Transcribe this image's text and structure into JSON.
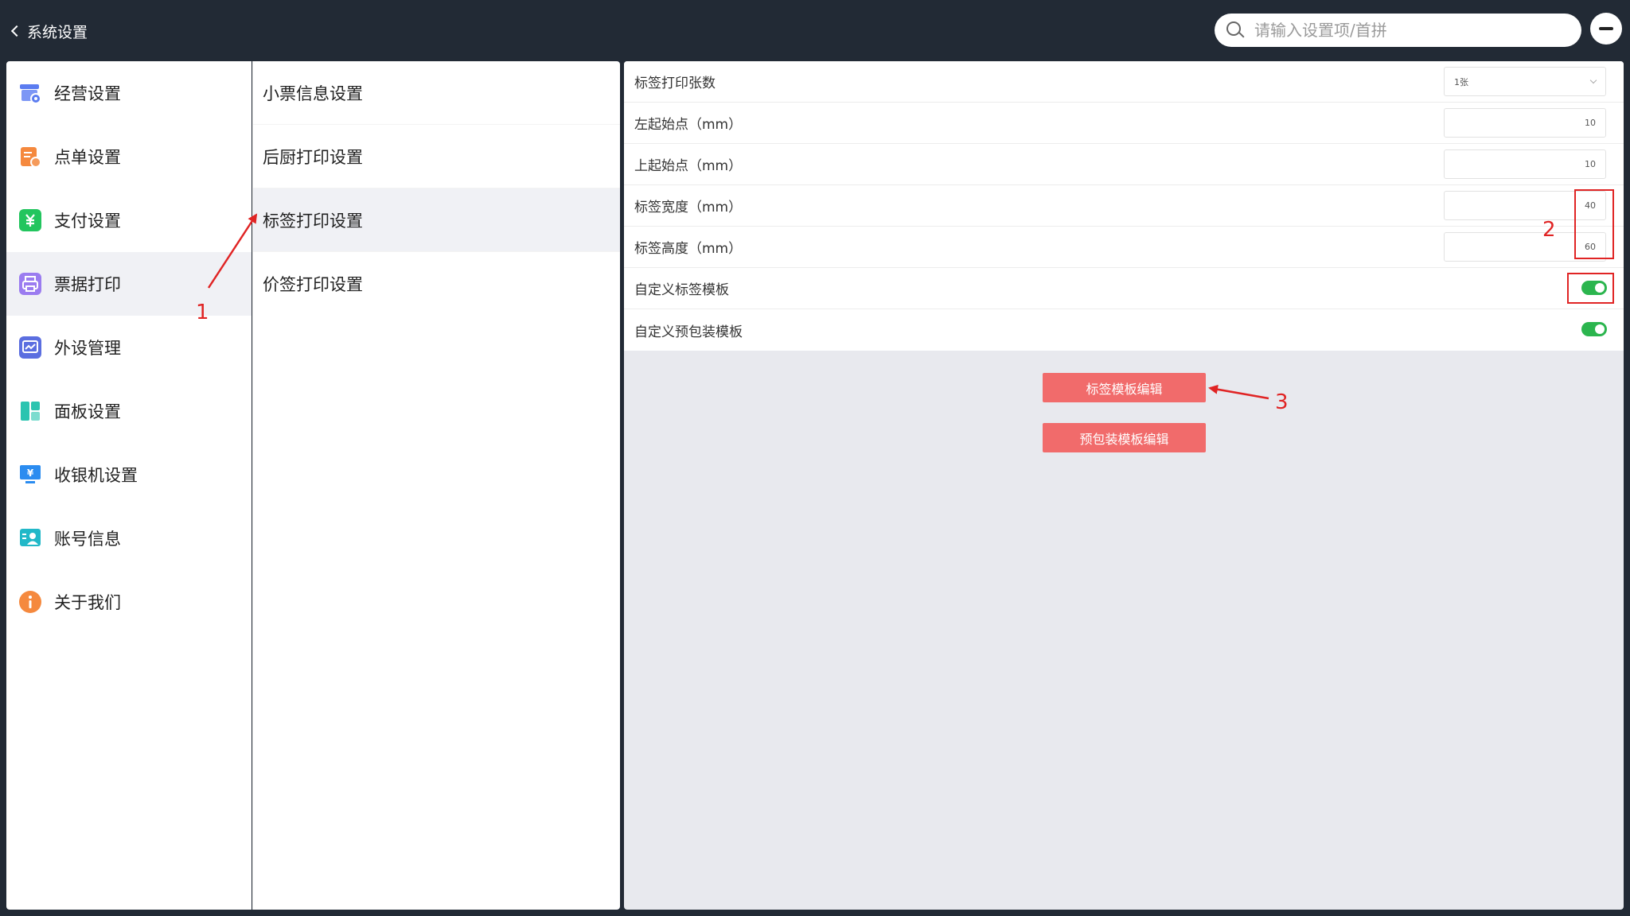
{
  "header": {
    "back_label": "系统设置",
    "search_placeholder": "请输入设置项/首拼"
  },
  "sidebar": {
    "items": [
      {
        "label": "经营设置",
        "icon": "store-settings-icon",
        "color": "#5b7cf0"
      },
      {
        "label": "点单设置",
        "icon": "order-icon",
        "color": "#f5893e"
      },
      {
        "label": "支付设置",
        "icon": "payment-yuan-icon",
        "color": "#22c55e"
      },
      {
        "label": "票据打印",
        "icon": "printer-icon",
        "color": "#9b7cf0"
      },
      {
        "label": "外设管理",
        "icon": "peripheral-icon",
        "color": "#5b6ee0"
      },
      {
        "label": "面板设置",
        "icon": "panel-layout-icon",
        "color": "#2bc4b0"
      },
      {
        "label": "收银机设置",
        "icon": "cash-register-icon",
        "color": "#2b8cf0"
      },
      {
        "label": "账号信息",
        "icon": "account-icon",
        "color": "#22b8c8"
      },
      {
        "label": "关于我们",
        "icon": "info-icon",
        "color": "#f5893e"
      }
    ],
    "active_index": 3
  },
  "submenu": {
    "items": [
      {
        "label": "小票信息设置"
      },
      {
        "label": "后厨打印设置"
      },
      {
        "label": "标签打印设置"
      },
      {
        "label": "价签打印设置"
      }
    ],
    "active_index": 2
  },
  "settings": {
    "rows": [
      {
        "label": "标签打印张数",
        "value": "1张"
      },
      {
        "label": "左起始点（mm）",
        "value": "10"
      },
      {
        "label": "上起始点（mm）",
        "value": "10"
      },
      {
        "label": "标签宽度（mm）",
        "value": "40"
      },
      {
        "label": "标签高度（mm）",
        "value": "60"
      },
      {
        "label": "自定义标签模板",
        "on": true
      },
      {
        "label": "自定义预包装模板",
        "on": true
      }
    ],
    "buttons": {
      "label_template": "标签模板编辑",
      "prepack_template": "预包装模板编辑"
    }
  },
  "annotations": {
    "n1": "1",
    "n2": "2",
    "n3": "3",
    "color": "#e02424"
  },
  "colors": {
    "topbar": "#222a35",
    "button": "#f16b6b",
    "toggle_on": "#2bb54e"
  }
}
